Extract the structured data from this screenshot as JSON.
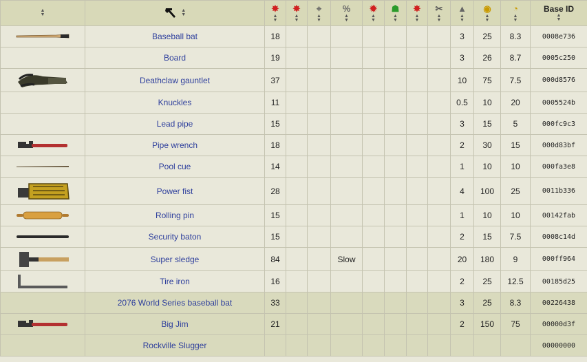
{
  "header": {
    "col_image_sort": "sort-icon",
    "col_name_icon": "hammer-icon",
    "columns": [
      {
        "icon": "damage-star-icon",
        "glyph": "✸",
        "cls": "red"
      },
      {
        "icon": "damage-per-second-star-icon",
        "glyph": "✸",
        "cls": "red"
      },
      {
        "icon": "crosshair-icon",
        "glyph": "⌖",
        "cls": "grey"
      },
      {
        "icon": "percent-icon",
        "glyph": "%",
        "cls": "grey"
      },
      {
        "icon": "critical-damage-icon",
        "glyph": "✹",
        "cls": "red"
      },
      {
        "icon": "strength-man-icon",
        "glyph": "☗",
        "cls": "green"
      },
      {
        "icon": "critical-chance-icon",
        "glyph": "✸",
        "cls": "red"
      },
      {
        "icon": "wrench-icon",
        "glyph": "✂",
        "cls": "wrench"
      },
      {
        "icon": "weight-icon",
        "glyph": "▲",
        "cls": "grey"
      },
      {
        "icon": "caps-coins-icon",
        "glyph": "◉",
        "cls": "gold"
      },
      {
        "icon": "hp-pie-icon",
        "glyph": "◔",
        "cls": "gold"
      }
    ],
    "base_id_label": "Base ID"
  },
  "rows": [
    {
      "img": "bat",
      "name": "Baseball bat",
      "dmg": "18",
      "speed": "",
      "weight": "3",
      "value": "25",
      "hp": "8.3",
      "id": "0008e736",
      "h": "r-32",
      "hl": false
    },
    {
      "img": "",
      "name": "Board",
      "dmg": "19",
      "speed": "",
      "weight": "3",
      "value": "26",
      "hp": "8.7",
      "id": "0005c250",
      "h": "r-32",
      "hl": false
    },
    {
      "img": "claw",
      "name": "Deathclaw gauntlet",
      "dmg": "37",
      "speed": "",
      "weight": "10",
      "value": "75",
      "hp": "7.5",
      "id": "000d8576",
      "h": "r-35",
      "hl": false
    },
    {
      "img": "",
      "name": "Knuckles",
      "dmg": "11",
      "speed": "",
      "weight": "0.5",
      "value": "10",
      "hp": "20",
      "id": "0005524b",
      "h": "r-32",
      "hl": false
    },
    {
      "img": "",
      "name": "Lead pipe",
      "dmg": "15",
      "speed": "",
      "weight": "3",
      "value": "15",
      "hp": "5",
      "id": "000fc9c3",
      "h": "r-32",
      "hl": false
    },
    {
      "img": "wrench",
      "name": "Pipe wrench",
      "dmg": "18",
      "speed": "",
      "weight": "2",
      "value": "30",
      "hp": "15",
      "id": "000d83bf",
      "h": "r-32",
      "hl": false
    },
    {
      "img": "cue",
      "name": "Pool cue",
      "dmg": "14",
      "speed": "",
      "weight": "1",
      "value": "10",
      "hp": "10",
      "id": "000fa3e8",
      "h": "r-32",
      "hl": false
    },
    {
      "img": "fist",
      "name": "Power fist",
      "dmg": "28",
      "speed": "",
      "weight": "4",
      "value": "100",
      "hp": "25",
      "id": "0011b336",
      "h": "r-40",
      "hl": false
    },
    {
      "img": "pin",
      "name": "Rolling pin",
      "dmg": "15",
      "speed": "",
      "weight": "1",
      "value": "10",
      "hp": "10",
      "id": "00142fab",
      "h": "r-32",
      "hl": false
    },
    {
      "img": "baton",
      "name": "Security baton",
      "dmg": "15",
      "speed": "",
      "weight": "2",
      "value": "15",
      "hp": "7.5",
      "id": "0008c14d",
      "h": "r-32",
      "hl": false
    },
    {
      "img": "sledge",
      "name": "Super sledge",
      "dmg": "84",
      "speed": "Slow",
      "weight": "20",
      "value": "180",
      "hp": "9",
      "id": "000ff964",
      "h": "r-35",
      "hl": false
    },
    {
      "img": "tire",
      "name": "Tire iron",
      "dmg": "16",
      "speed": "",
      "weight": "2",
      "value": "25",
      "hp": "12.5",
      "id": "00185d25",
      "h": "r-32",
      "hl": false
    },
    {
      "img": "",
      "name": "2076 World Series baseball bat",
      "dmg": "33",
      "speed": "",
      "weight": "3",
      "value": "25",
      "hp": "8.3",
      "id": "00226438",
      "h": "r-32",
      "hl": true
    },
    {
      "img": "wrench",
      "name": "Big Jim",
      "dmg": "21",
      "speed": "",
      "weight": "2",
      "value": "150",
      "hp": "75",
      "id": "00000d3f",
      "h": "r-32",
      "hl": true
    },
    {
      "img": "",
      "name": "Rockville Slugger",
      "dmg": "",
      "speed": "",
      "weight": "",
      "value": "",
      "hp": "",
      "id": "00000000",
      "h": "r-32",
      "hl": true
    }
  ]
}
